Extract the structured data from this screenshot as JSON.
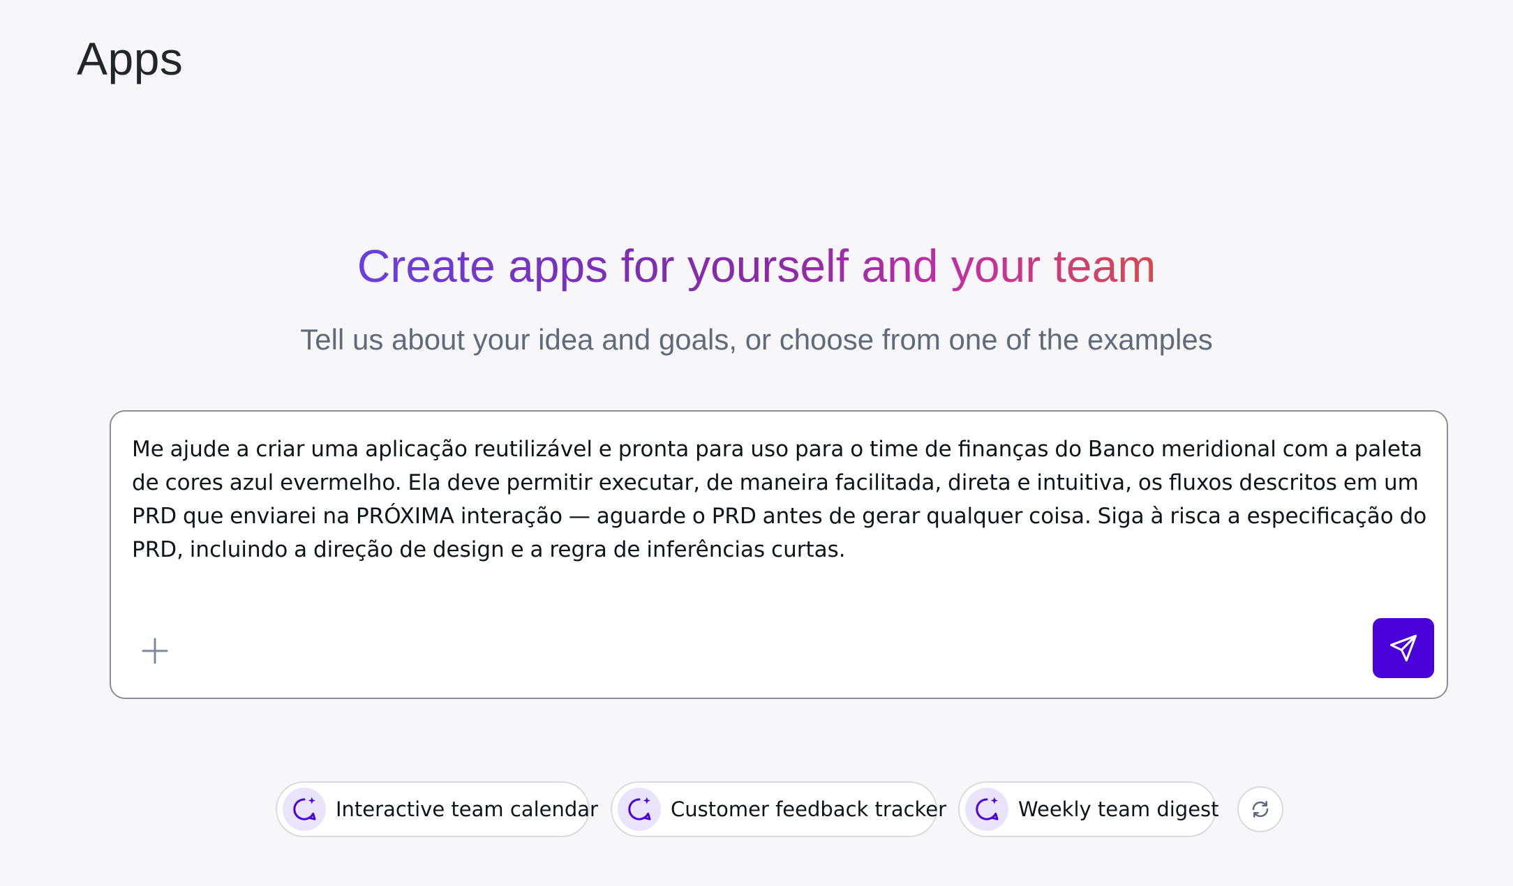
{
  "header": {
    "title": "Apps"
  },
  "hero": {
    "title": "Create apps for yourself and your team",
    "subtitle": "Tell us about your idea and goals, or choose from one of the examples"
  },
  "prompt": {
    "value": "Me ajude a criar uma aplicação reutilizável e pronta para uso para o time de finanças do Banco meridional com a paleta de cores azul evermelho. Ela deve permitir executar, de maneira facilitada, direta e intuitiva, os fluxos descritos em um PRD que enviarei na PRÓXIMA interação — aguarde o PRD antes de gerar qualquer coisa. Siga à risca a especificação do PRD, incluindo a direção de design e a regra de inferências curtas.",
    "attach_icon": "plus-icon",
    "send_icon": "send-icon"
  },
  "examples": [
    {
      "label": "Interactive team calendar",
      "icon": "sparkle-chat-icon"
    },
    {
      "label": "Customer feedback tracker",
      "icon": "sparkle-chat-icon"
    },
    {
      "label": "Weekly team digest",
      "icon": "sparkle-chat-icon"
    }
  ],
  "refresh": {
    "icon": "refresh-icon"
  },
  "colors": {
    "background": "#f7f7f9",
    "accent": "#4a00d8",
    "chip_icon_bg": "#e9e4fb",
    "gradient_start": "#6a3fe0",
    "gradient_mid": "#8a2aa6",
    "gradient_end": "#d64a4e"
  }
}
